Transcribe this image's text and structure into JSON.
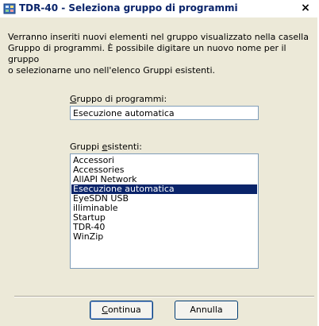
{
  "window": {
    "title": "TDR-40 - Seleziona gruppo di programmi",
    "close_glyph": "×"
  },
  "intro": {
    "line1": "Verranno inseriti nuovi elementi nel gruppo visualizzato nella casella",
    "line2": "Gruppo di programmi. È possibile digitare un nuovo nome per il gruppo",
    "line3": "o selezionarne uno nell'elenco Gruppi esistenti."
  },
  "group_field": {
    "label_mnemonic": "G",
    "label_rest": "ruppo di programmi:",
    "value": "Esecuzione automatica"
  },
  "existing_groups": {
    "label_start": "Gruppi ",
    "label_mnemonic": "e",
    "label_end": "sistenti:",
    "items": [
      {
        "label": "Accessori"
      },
      {
        "label": "Accessories"
      },
      {
        "label": "AllAPI Network"
      },
      {
        "label": "Esecuzione automatica"
      },
      {
        "label": "EyeSDN USB"
      },
      {
        "label": "illiminable"
      },
      {
        "label": "Startup"
      },
      {
        "label": "TDR-40"
      },
      {
        "label": "WinZip"
      }
    ],
    "selected_index": 3
  },
  "buttons": {
    "continue_mnemonic": "C",
    "continue_rest": "ontinua",
    "cancel": "Annulla"
  },
  "colors": {
    "selection": "#0a246a",
    "title_text": "#0a246a",
    "dialog_bg": "#ece9d8"
  },
  "icons": {
    "app": "program-group-icon",
    "close": "close-icon"
  }
}
